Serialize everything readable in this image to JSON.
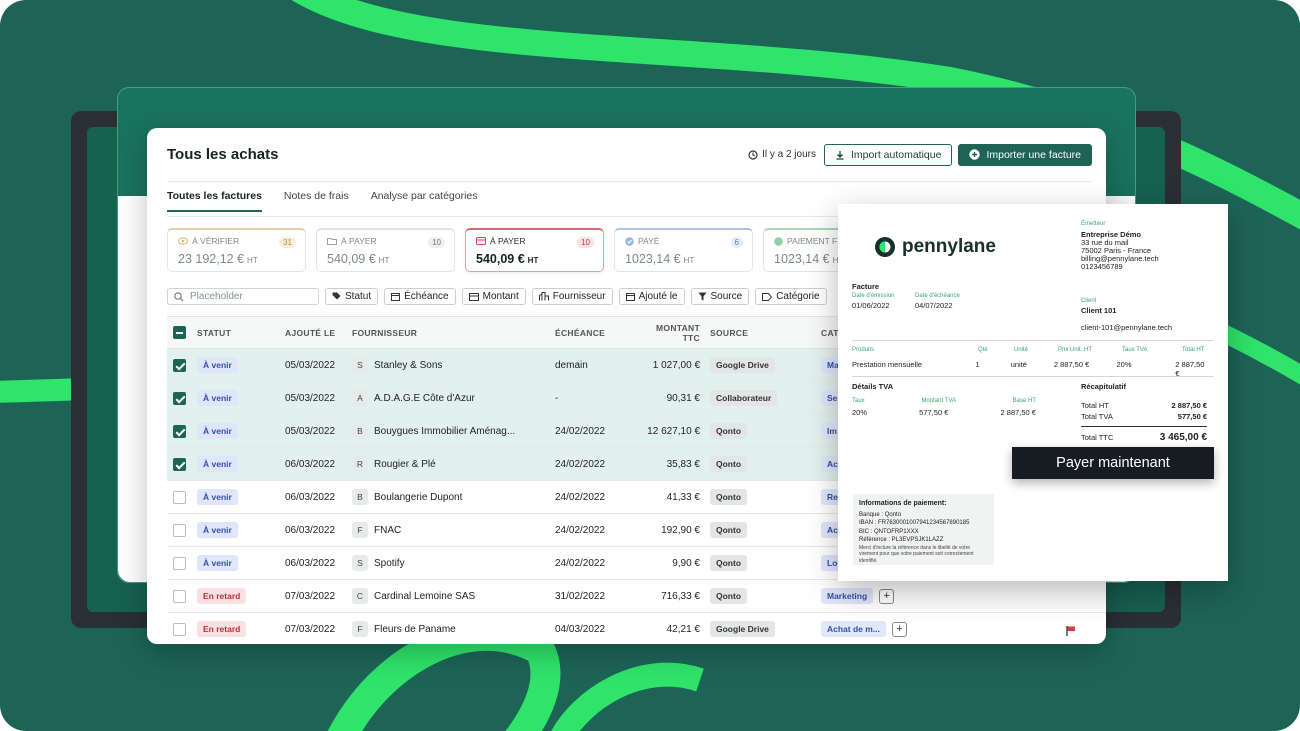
{
  "header": {
    "title": "Tous les achats",
    "timestamp": "Il y a 2 jours",
    "import_auto_label": "Import automatique",
    "import_invoice_label": "Importer une facture"
  },
  "tabs": [
    {
      "label": "Toutes les factures",
      "active": true
    },
    {
      "label": "Notes de frais",
      "active": false
    },
    {
      "label": "Analyse par catégories",
      "active": false
    }
  ],
  "cards": [
    {
      "label": "À VÉRIFIER",
      "count": "31",
      "amount": "23 192,12 €",
      "unit": "HT",
      "icon": "eye-icon"
    },
    {
      "label": "À PAYER",
      "count": "10",
      "amount": "540,09 €",
      "unit": "HT",
      "icon": "folder-icon"
    },
    {
      "label": "À PAYER",
      "count": "10",
      "amount": "540,09 €",
      "unit": "HT",
      "icon": "card-icon"
    },
    {
      "label": "PAYÉ",
      "count": "6",
      "amount": "1023,14 €",
      "unit": "HT",
      "icon": "check-circle-icon"
    },
    {
      "label": "PAIEMENT F",
      "count": "",
      "amount": "1023,14 €",
      "unit": "HT",
      "icon": "dollar-circle-icon"
    }
  ],
  "filters": {
    "search_placeholder": "Placeholder",
    "chips": [
      "Statut",
      "Échéance",
      "Montant",
      "Fournisseur",
      "Ajouté le",
      "Source",
      "Catégorie"
    ]
  },
  "table": {
    "columns": [
      "STATUT",
      "AJOUTÉ LE",
      "FOURNISSEUR",
      "ÉCHÉANCE",
      "MONTANT TTC",
      "SOURCE",
      "CAT"
    ],
    "rows": [
      {
        "checked": true,
        "status": "À venir",
        "status_type": "venir",
        "added": "05/03/2022",
        "initial": "S",
        "supplier": "Stanley & Sons",
        "due": "demain",
        "amount": "1 027,00 €",
        "source": "Google Drive",
        "category": "Ma"
      },
      {
        "checked": true,
        "status": "À venir",
        "status_type": "venir",
        "added": "05/03/2022",
        "initial": "A",
        "supplier": "A.D.A.G.E Côte d'Azur",
        "due": "-",
        "amount": "90,31 €",
        "source": "Collaborateur",
        "category": "Se"
      },
      {
        "checked": true,
        "status": "À venir",
        "status_type": "venir",
        "added": "05/03/2022",
        "initial": "B",
        "supplier": "Bouygues Immobilier Aménag...",
        "due": "24/02/2022",
        "amount": "12 627,10 €",
        "source": "Qonto",
        "category": "Im"
      },
      {
        "checked": true,
        "status": "À venir",
        "status_type": "venir",
        "added": "06/03/2022",
        "initial": "R",
        "supplier": "Rougier & Plé",
        "due": "24/02/2022",
        "amount": "35,83 €",
        "source": "Qonto",
        "category": "Ac"
      },
      {
        "checked": false,
        "status": "À venir",
        "status_type": "venir",
        "added": "06/03/2022",
        "initial": "B",
        "supplier": "Boulangerie Dupont",
        "due": "24/02/2022",
        "amount": "41,33 €",
        "source": "Qonto",
        "category": "Re"
      },
      {
        "checked": false,
        "status": "À venir",
        "status_type": "venir",
        "added": "06/03/2022",
        "initial": "F",
        "supplier": "FNAC",
        "due": "24/02/2022",
        "amount": "192,90 €",
        "source": "Qonto",
        "category": "Ac"
      },
      {
        "checked": false,
        "status": "À venir",
        "status_type": "venir",
        "added": "06/03/2022",
        "initial": "S",
        "supplier": "Spotify",
        "due": "24/02/2022",
        "amount": "9,90 €",
        "source": "Qonto",
        "category": "Lo"
      },
      {
        "checked": false,
        "status": "En retard",
        "status_type": "retard",
        "added": "07/03/2022",
        "initial": "C",
        "supplier": "Cardinal Lemoine SAS",
        "due": "31/02/2022",
        "amount": "716,33 €",
        "source": "Qonto",
        "category": "Marketing"
      },
      {
        "checked": false,
        "status": "En retard",
        "status_type": "retard",
        "added": "07/03/2022",
        "initial": "F",
        "supplier": "Fleurs de Paname",
        "due": "04/03/2022",
        "amount": "42,21 €",
        "source": "Google Drive",
        "category": "Achat de m..."
      }
    ]
  },
  "invoice": {
    "brand": "pennylane",
    "emitter_label": "Émetteur",
    "emitter_name": "Entreprise Démo",
    "emitter_lines": [
      "33 rue du mail",
      "75002 Paris - France",
      "billing@pennylane.tech",
      "0123456789"
    ],
    "doc_title": "Facture",
    "date_emission_label": "Date d'émission",
    "date_emission": "01/06/2022",
    "date_due_label": "Date d'échéance",
    "date_due": "04/07/2022",
    "client_label": "Client",
    "client_name": "Client 101",
    "client_email": "client-101@pennylane.tech",
    "product_headers": [
      "Produits",
      "Qté",
      "Unité",
      "Prix Unit. HT",
      "Taux TVA",
      "Total HT"
    ],
    "product_row": [
      "Prestation mensuelle",
      "1",
      "unité",
      "2 887,50 €",
      "20%",
      "2 887,50 €"
    ],
    "tva_title": "Détails TVA",
    "tva_headers": [
      "Taux",
      "Montant TVA",
      "Base HT"
    ],
    "tva_row": [
      "20%",
      "577,50 €",
      "2 887,50 €"
    ],
    "recap_title": "Récapitulatif",
    "recap_ht_label": "Total HT",
    "recap_ht": "2 887,50 €",
    "recap_tva_label": "Total TVA",
    "recap_tva": "577,50 €",
    "recap_ttc_label": "Total TTC",
    "recap_ttc": "3 465,00 €",
    "pay_now": "Payer maintenant",
    "pay_info_title": "Informations de paiement:",
    "pay_bank": "Banque : Qonto",
    "pay_iban": "IBAN : FR7630001007941234567890185",
    "pay_bic": "BIC : QNTOFRP1XXX",
    "pay_ref": "Référence : PL3EVPSJK1LAZZ",
    "pay_note": "Merci d'inclure la référence dans le libellé de votre virement pour que votre paiement soit correctement identifié."
  },
  "colors": {
    "brand": "#1d6457",
    "accent_green": "#2ee66b",
    "late": "#b9303b",
    "upcoming": "#3350a8"
  }
}
